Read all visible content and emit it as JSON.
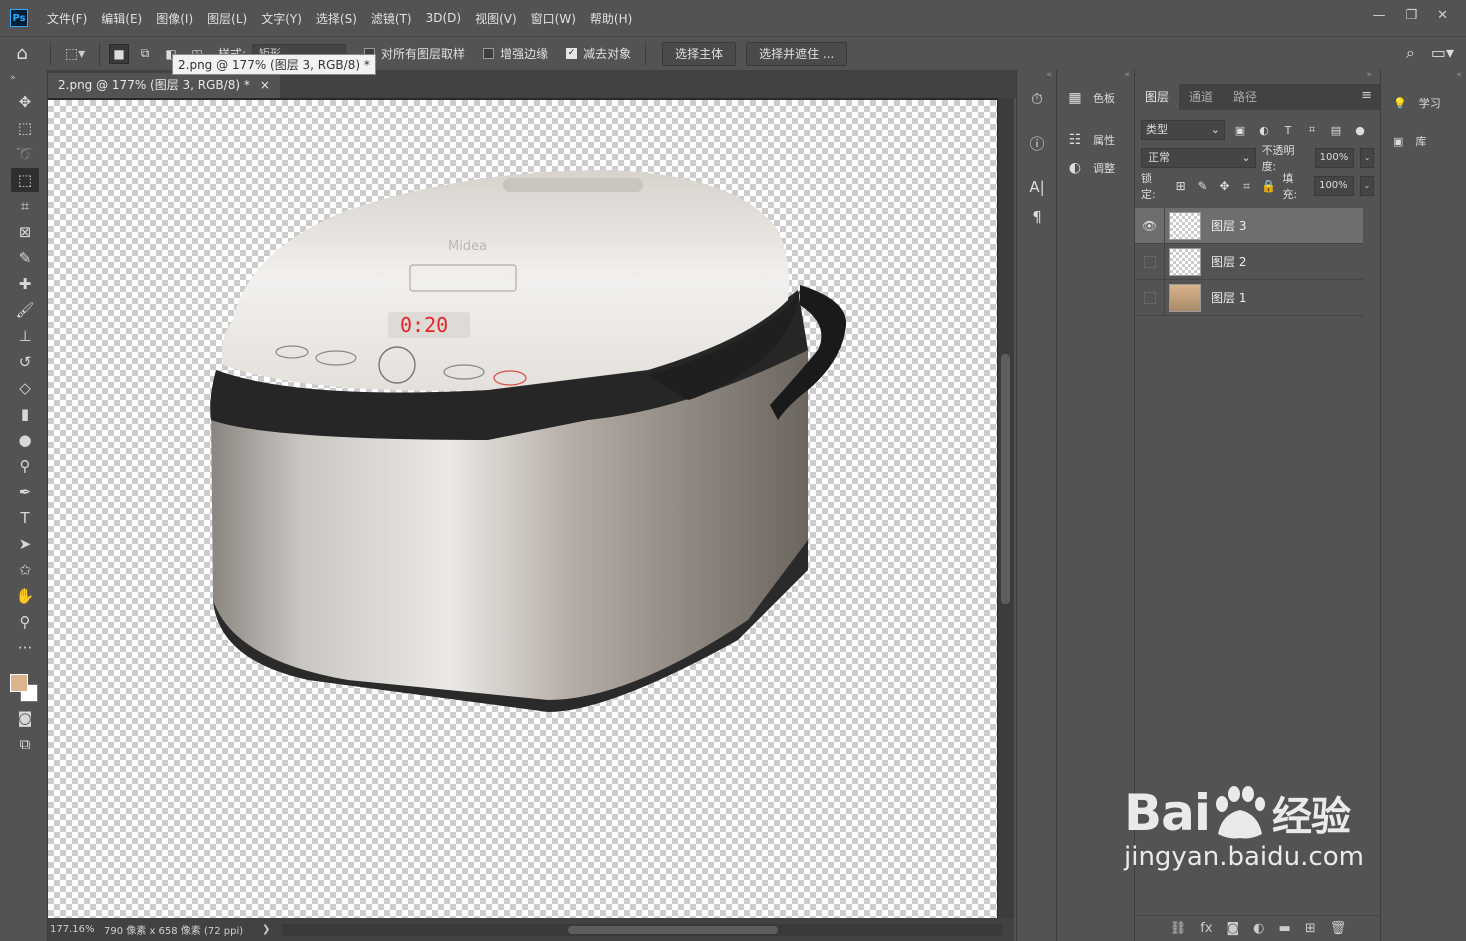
{
  "menubar": {
    "logo": "Ps",
    "items": [
      "文件(F)",
      "编辑(E)",
      "图像(I)",
      "图层(L)",
      "文字(Y)",
      "选择(S)",
      "滤镜(T)",
      "3D(D)",
      "视图(V)",
      "窗口(W)",
      "帮助(H)"
    ],
    "controls": {
      "minimize": "—",
      "restore": "❐",
      "close": "✕"
    }
  },
  "options": {
    "style_label": "样式:",
    "mode_value": "矩形",
    "sample_all_layers": "对所有图层取样",
    "enhance_edges": "增强边缘",
    "subtract_object": "减去对象",
    "subtract_checked": true,
    "select_subject": "选择主体",
    "select_and_mask": "选择并遮住 ..."
  },
  "tooltip": "2.png @ 177% (图层 3, RGB/8) *",
  "document": {
    "tab_title": "2.png @ 177% (图层 3, RGB/8) *",
    "close": "×"
  },
  "status": {
    "zoom": "177.16%",
    "info": "790 像素 x 658 像素 (72 ppi)",
    "arrow": "❯"
  },
  "dock2": {
    "swatches": "色板",
    "properties": "属性",
    "adjustments": "调整"
  },
  "layers_panel": {
    "tabs": [
      "图层",
      "通道",
      "路径"
    ],
    "filter_label": "类型",
    "blend_mode": "正常",
    "opacity_label": "不透明度:",
    "opacity_value": "100%",
    "lock_label": "锁定:",
    "fill_label": "填充:",
    "fill_value": "100%",
    "layers": [
      {
        "name": "图层 3",
        "visible": true,
        "selected": true
      },
      {
        "name": "图层 2",
        "visible": false,
        "selected": false
      },
      {
        "name": "图层 1",
        "visible": false,
        "selected": false
      }
    ]
  },
  "dock3": {
    "learn": "学习",
    "libraries": "库"
  },
  "watermark": {
    "brand": "Bai",
    "brand_suffix": "经验",
    "url": "jingyan.baidu.com"
  },
  "product_text": {
    "brand": "Midea",
    "display": "0:20"
  },
  "colors": {
    "foreground": "#d9b48c",
    "background": "#ffffff",
    "ui_bg": "#535353"
  }
}
